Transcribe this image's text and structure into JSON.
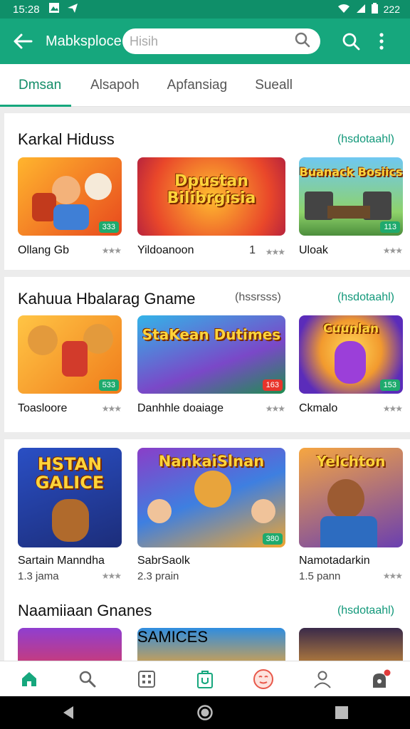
{
  "status_bar": {
    "time": "15:28",
    "right_text": "222"
  },
  "app_bar": {
    "title": "Mabksploce",
    "search_placeholder": "Hisih",
    "accent": "#16a77d"
  },
  "tabs": [
    {
      "label": "Dmsan",
      "active": true
    },
    {
      "label": "Alsapoh"
    },
    {
      "label": "Apfansiag"
    },
    {
      "label": "Sueall"
    }
  ],
  "sections": [
    {
      "title": "Karkal Hiduss",
      "see_more": "(hsdotaahl)",
      "games": [
        {
          "name": "Ollang Gb",
          "badge": "333",
          "meta": ""
        },
        {
          "name": "Yildoanoon",
          "thumb_text": "Dpustan Bilibrgisia",
          "meta": "1"
        },
        {
          "name": "Uloak",
          "thumb_text": "Buanack Bosiics",
          "badge": "113"
        }
      ]
    },
    {
      "title": "Kahuua Hbalarag Gname",
      "subtitle": "(hssrsss)",
      "see_more": "(hsdotaahl)",
      "games": [
        {
          "name": "Toasloore",
          "badge": "533"
        },
        {
          "name": "Danhhle doaiage",
          "thumb_text": "StaKean Dutimes",
          "badge": "163"
        },
        {
          "name": "Ckmalo",
          "thumb_text": "Cuunlan",
          "badge": "153"
        }
      ]
    },
    {
      "games": [
        {
          "name": "Sartain Manndha",
          "meta": "1.3 jama",
          "thumb_text": "HSTAN GALICE"
        },
        {
          "name": "SabrSaolk",
          "meta": "2.3 prain",
          "thumb_text": "NankaiSlnan",
          "badge": "380"
        },
        {
          "name": "Namotadarkin",
          "meta": "1.5 pann",
          "thumb_text": "Yelchton"
        }
      ]
    },
    {
      "title": "Naamiiaan Gnanes",
      "see_more": "(hsdotaahl)",
      "games": [
        {
          "thumb_text": ""
        },
        {
          "thumb_text": "SAMICES"
        },
        {
          "thumb_text": ""
        }
      ]
    }
  ]
}
